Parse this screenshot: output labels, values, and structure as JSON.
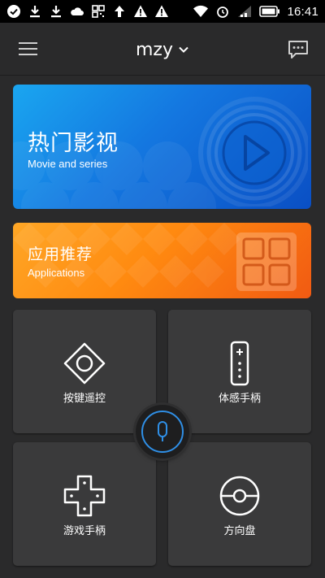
{
  "status_bar": {
    "time": "16:41",
    "left_icons": [
      "check-circle-icon",
      "download-icon",
      "download-icon",
      "cloud-icon",
      "qr-code-icon",
      "upload-arrow-icon",
      "warning-icon",
      "warning-icon"
    ],
    "right_icons": [
      "wifi-icon",
      "alarm-icon",
      "signal-icon",
      "battery-icon"
    ]
  },
  "header": {
    "title": "mzy",
    "menu_icon": "hamburger-menu-icon",
    "dropdown_icon": "chevron-down-icon",
    "message_icon": "message-bubble-icon"
  },
  "banners": {
    "movie": {
      "title": "热门影视",
      "subtitle": "Movie and series",
      "icon": "play-icon",
      "color": "#1477e0"
    },
    "apps": {
      "title": "应用推荐",
      "subtitle": "Applications",
      "icon": "app-grid-icon",
      "color": "#ff8a10"
    }
  },
  "tiles": [
    {
      "label": "按键遥控",
      "icon": "dpad-remote-icon"
    },
    {
      "label": "体感手柄",
      "icon": "motion-remote-icon"
    },
    {
      "label": "游戏手柄",
      "icon": "gamepad-icon"
    },
    {
      "label": "方向盘",
      "icon": "steering-wheel-icon"
    }
  ],
  "voice_button": {
    "icon": "microphone-icon",
    "accent_color": "#2f8fe6"
  },
  "colors": {
    "background": "#2a2a2b",
    "tile": "#3a3a3b",
    "status_bar": "#000000"
  }
}
